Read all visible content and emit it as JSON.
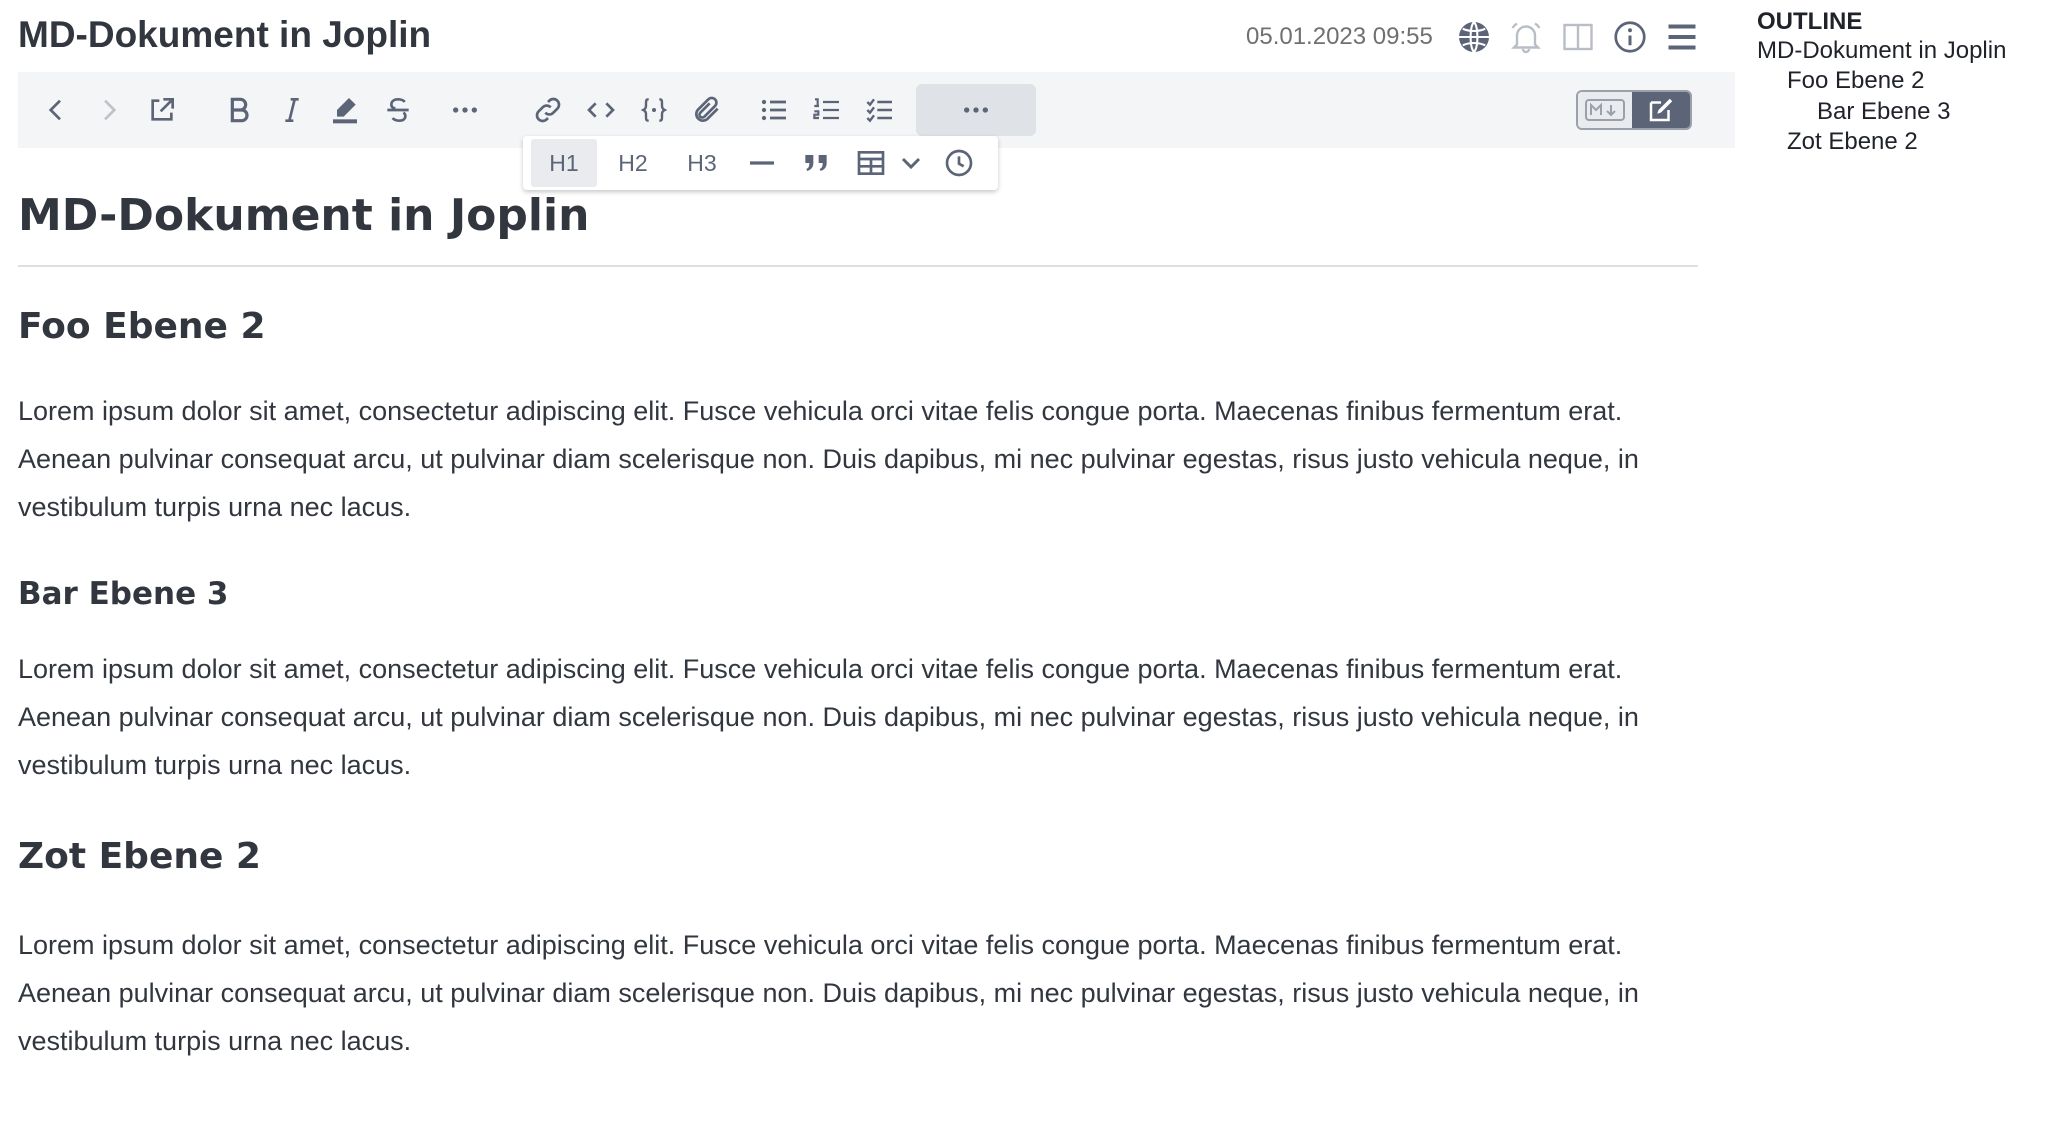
{
  "header": {
    "title": "MD-Dokument in Joplin",
    "date": "05.01.2023 09:55",
    "icons": [
      "globe-icon",
      "bell-icon",
      "split-view-icon",
      "info-icon",
      "menu-icon"
    ]
  },
  "toolbar": {
    "buttons": [
      "back-icon",
      "forward-icon",
      "external-edit-icon",
      "bold-icon",
      "italic-icon",
      "highlight-icon",
      "strikethrough-icon",
      "more-icon",
      "link-icon",
      "code-icon",
      "code-block-icon",
      "attachment-icon",
      "bullet-list-icon",
      "numbered-list-icon",
      "checklist-icon",
      "more-icon"
    ],
    "mode_toggle": {
      "markdown_label": "M↓",
      "active": "editor"
    }
  },
  "dropdown": {
    "h1": "H1",
    "h2": "H2",
    "h3": "H3",
    "active": "H1"
  },
  "document": {
    "h1": "MD-Dokument in Joplin",
    "section1_title": "Foo Ebene 2",
    "section1_text": "Lorem ipsum dolor sit amet, consectetur adipiscing elit. Fusce vehicula orci vitae felis congue porta. Maecenas finibus fermentum erat. Aenean pulvinar consequat arcu, ut pulvinar diam scelerisque non. Duis dapibus, mi nec pulvinar egestas, risus justo vehicula neque, in vestibulum turpis urna nec lacus.",
    "section2_title": "Bar Ebene 3",
    "section2_text": "Lorem ipsum dolor sit amet, consectetur adipiscing elit. Fusce vehicula orci vitae felis congue porta. Maecenas finibus fermentum erat. Aenean pulvinar consequat arcu, ut pulvinar diam scelerisque non. Duis dapibus, mi nec pulvinar egestas, risus justo vehicula neque, in vestibulum turpis urna nec lacus.",
    "section3_title": "Zot Ebene 2",
    "section3_text": "Lorem ipsum dolor sit amet, consectetur adipiscing elit. Fusce vehicula orci vitae felis congue porta. Maecenas finibus fermentum erat. Aenean pulvinar consequat arcu, ut pulvinar diam scelerisque non. Duis dapibus, mi nec pulvinar egestas, risus justo vehicula neque, in vestibulum turpis urna nec lacus."
  },
  "outline": {
    "heading": "OUTLINE",
    "items": [
      {
        "label": "MD-Dokument in Joplin",
        "level": 1
      },
      {
        "label": "Foo Ebene 2",
        "level": 2
      },
      {
        "label": "Bar Ebene 3",
        "level": 3
      },
      {
        "label": "Zot Ebene 2",
        "level": 2
      }
    ]
  },
  "colors": {
    "text": "#32373f",
    "toolbar_bg": "#f4f5f6",
    "icon": "#5b6577",
    "active_mode_bg": "#5b6577"
  }
}
